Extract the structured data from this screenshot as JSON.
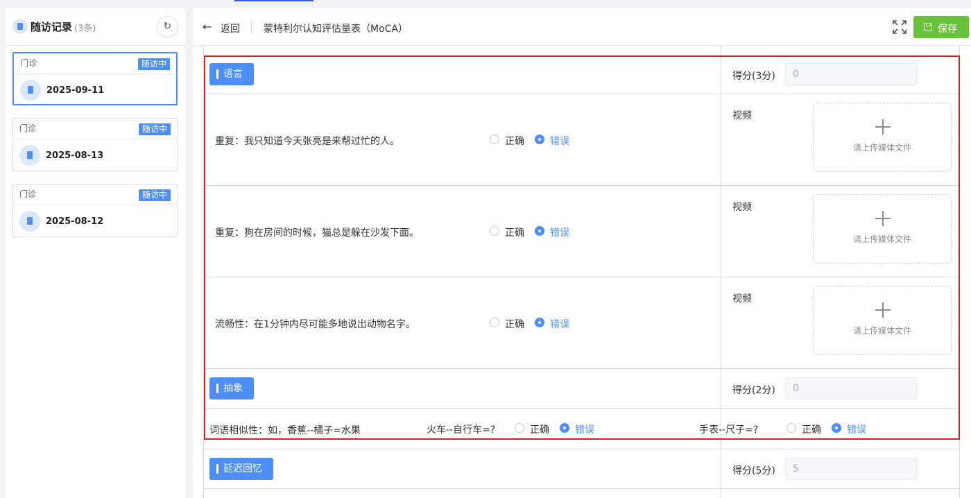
{
  "sidebar": {
    "title": "随访记录",
    "count": "(3条)",
    "records": [
      {
        "type": "门诊",
        "status": "随访中",
        "date": "2025-09-11"
      },
      {
        "type": "门诊",
        "status": "随访中",
        "date": "2025-08-13"
      },
      {
        "type": "门诊",
        "status": "随访中",
        "date": "2025-08-12"
      }
    ]
  },
  "header": {
    "back_label": "返回",
    "title": "蒙特利尔认知评估量表（MoCA）",
    "save_label": "保存"
  },
  "sections": {
    "language": {
      "label": "语言",
      "score_label": "得分(3分)",
      "score_value": "0",
      "questions": [
        {
          "text": "重复：我只知道今天张亮是来帮过忙的人。",
          "opt_correct": "正确",
          "opt_wrong": "错误",
          "selected": "错误",
          "video_label": "视频",
          "upload_text": "请上传媒体文件"
        },
        {
          "text": "重复：狗在房间的时候，猫总是躲在沙发下面。",
          "opt_correct": "正确",
          "opt_wrong": "错误",
          "selected": "错误",
          "video_label": "视频",
          "upload_text": "请上传媒体文件"
        },
        {
          "text": "流畅性：在1分钟内尽可能多地说出动物名字。",
          "opt_correct": "正确",
          "opt_wrong": "错误",
          "selected": "错误",
          "video_label": "视频",
          "upload_text": "请上传媒体文件"
        }
      ]
    },
    "abstraction": {
      "label": "抽象",
      "score_label": "得分(2分)",
      "score_value": "0",
      "prompt": "词语相似性：如，香蕉--橘子=水果",
      "items": [
        {
          "text": "火车--自行车=?",
          "opt_correct": "正确",
          "opt_wrong": "错误",
          "selected": "错误"
        },
        {
          "text": "手表--尺子=?",
          "opt_correct": "正确",
          "opt_wrong": "错误",
          "selected": "错误"
        }
      ]
    },
    "delayed_recall": {
      "label": "延迟回忆",
      "score_label": "得分(5分)",
      "score_value": "5"
    }
  },
  "colors": {
    "accent": "#4e8ef7",
    "save": "#67c23a",
    "highlight_border": "#e02020"
  }
}
